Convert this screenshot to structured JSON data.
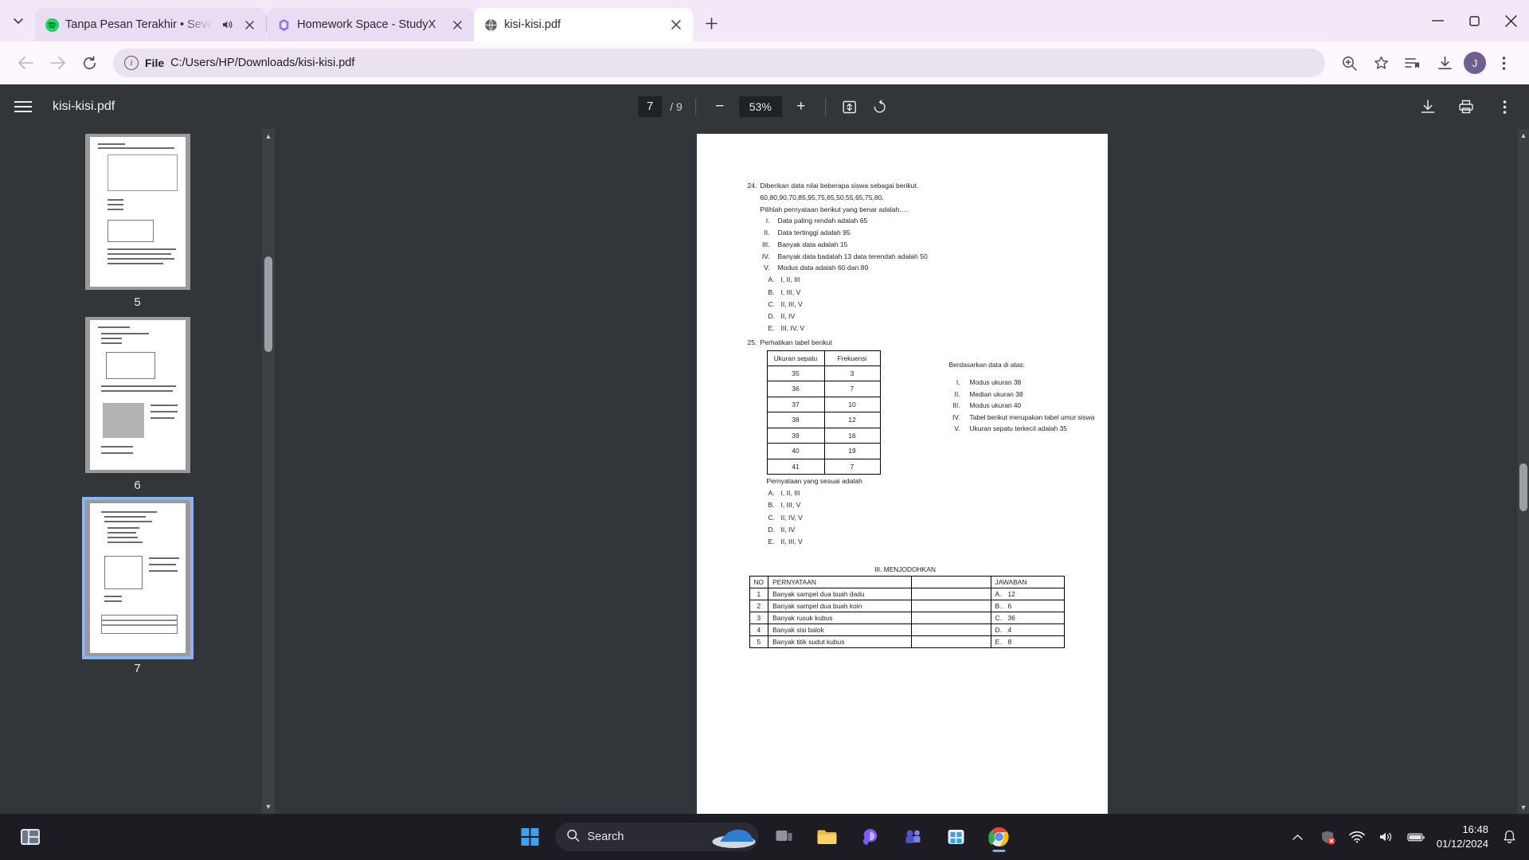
{
  "browser": {
    "tabs": [
      {
        "title": "Tanpa Pesan Terakhir • Seve",
        "favicon": "spotify-icon",
        "audio": true,
        "active": false
      },
      {
        "title": "Homework Space - StudyX",
        "favicon": "studyx-icon",
        "audio": false,
        "active": false
      },
      {
        "title": "kisi-kisi.pdf",
        "favicon": "globe-icon",
        "audio": false,
        "active": true
      }
    ],
    "new_tab_label": "+",
    "window_controls": {
      "minimize": "—",
      "maximize": "⬜",
      "close": "✕"
    },
    "nav": {
      "back": "←",
      "forward": "→",
      "reload": "⟳"
    },
    "omnibox": {
      "scheme_label": "File",
      "url": "C:/Users/HP/Downloads/kisi-kisi.pdf",
      "info_icon": "ⓘ"
    },
    "toolbar_icons": [
      "zoom-icon",
      "bookmark-star-icon",
      "reading-list-icon",
      "download-icon"
    ],
    "profile_initial": "J"
  },
  "pdf": {
    "file_name": "kisi-kisi.pdf",
    "page_current": "7",
    "page_total": "/ 9",
    "zoom_level": "53%",
    "zoom_out_label": "−",
    "zoom_in_label": "+",
    "fit_label": "fit-to-page-icon",
    "rotate_label": "rotate-icon",
    "download_label": "download-icon",
    "print_label": "print-icon",
    "menu_label": "more-menu-icon",
    "thumbnails": [
      {
        "number": "5",
        "selected": false
      },
      {
        "number": "6",
        "selected": false
      },
      {
        "number": "7",
        "selected": true
      }
    ]
  },
  "document": {
    "q24": {
      "number": "24.",
      "line1": "Diberikan data nilai beberapa siswa sebagai berikut.",
      "line2": "60,80,90,70,85,95,75,65,50,55,65,75,80.",
      "line3": "Pilihlah pernyataan berikut yang benar adalah….",
      "statements": [
        {
          "rn": "I.",
          "text": "Data paling rendah adalah 65"
        },
        {
          "rn": "II.",
          "text": "Data tertinggi adalah 95"
        },
        {
          "rn": "III.",
          "text": "Banyak data adalah 15"
        },
        {
          "rn": "IV.",
          "text": "Banyak data badalah 13 data terendah adalah 50"
        },
        {
          "rn": "V.",
          "text": "Modus data adalah 60 dan 80"
        }
      ],
      "options": [
        {
          "letter": "A.",
          "text": "I, II, III"
        },
        {
          "letter": "B.",
          "text": "I, III, V"
        },
        {
          "letter": "C.",
          "text": "II, III, V"
        },
        {
          "letter": "D.",
          "text": "II, IV"
        },
        {
          "letter": "E.",
          "text": "III, IV, V"
        }
      ]
    },
    "q25": {
      "number": "25.",
      "line1": "Perhatikan tabel berikut",
      "table": {
        "headers": [
          "Ukuran sepatu",
          "Frekuensi"
        ],
        "rows": [
          [
            "35",
            "3"
          ],
          [
            "36",
            "7"
          ],
          [
            "37",
            "10"
          ],
          [
            "38",
            "12"
          ],
          [
            "39",
            "16"
          ],
          [
            "40",
            "19"
          ],
          [
            "41",
            "7"
          ]
        ]
      },
      "side_title": "Berdasarkan data di atas:",
      "side_statements": [
        {
          "rn": "I.",
          "text": "Modus ukuran 38"
        },
        {
          "rn": "II.",
          "text": "Median ukuran 38"
        },
        {
          "rn": "III.",
          "text": "Modus ukuran 40"
        },
        {
          "rn": "IV.",
          "text": "Tabel berikut merupakan tabel umur siswa"
        },
        {
          "rn": "V.",
          "text": "Ukuran sepatu terkecil adalah 35"
        }
      ],
      "prompt": "Pernyataan yang sesuai adalah",
      "options": [
        {
          "letter": "A.",
          "text": "I, II, III"
        },
        {
          "letter": "B.",
          "text": "I, III, V"
        },
        {
          "letter": "C.",
          "text": "II, IV, V"
        },
        {
          "letter": "D.",
          "text": "II, IV"
        },
        {
          "letter": "E.",
          "text": "II, III, V"
        }
      ]
    },
    "matching": {
      "title": "III. MENJODOHKAN",
      "headers": [
        "NO",
        "PERNYATAAN",
        "",
        "JAWABAN"
      ],
      "rows": [
        {
          "no": "1",
          "statement": "Banyak sampel dua buah dadu",
          "blank": "",
          "ans_letter": "A.",
          "ans_value": "12"
        },
        {
          "no": "2",
          "statement": "Banyak sampel dua buah koin",
          "blank": "",
          "ans_letter": "B.",
          "ans_value": "6"
        },
        {
          "no": "3",
          "statement": "Banyak rusuk kubus",
          "blank": "",
          "ans_letter": "C.",
          "ans_value": "36"
        },
        {
          "no": "4",
          "statement": "Banyak sisi balok",
          "blank": "",
          "ans_letter": "D.",
          "ans_value": "4"
        },
        {
          "no": "5",
          "statement": "Banyak titik sudut kubus",
          "blank": "",
          "ans_letter": "E.",
          "ans_value": "8"
        }
      ]
    }
  },
  "taskbar": {
    "search_placeholder": "Search",
    "icons": [
      "widgets-icon",
      "start-icon",
      "search-box",
      "task-view-icon",
      "file-explorer-icon",
      "copilot-icon",
      "teams-icon",
      "store-icon",
      "chrome-icon"
    ],
    "tray": [
      "chevron-up-icon",
      "antivirus-icon",
      "wifi-icon",
      "volume-icon",
      "battery-icon",
      "notification-icon"
    ],
    "time": "16:48",
    "date": "01/12/2024"
  },
  "colors": {
    "chrome_tabstrip": "#f3e8f7",
    "pdf_toolbar": "#323639",
    "accent_blue": "#8ab4f8",
    "taskbar": "#1c1c22"
  }
}
